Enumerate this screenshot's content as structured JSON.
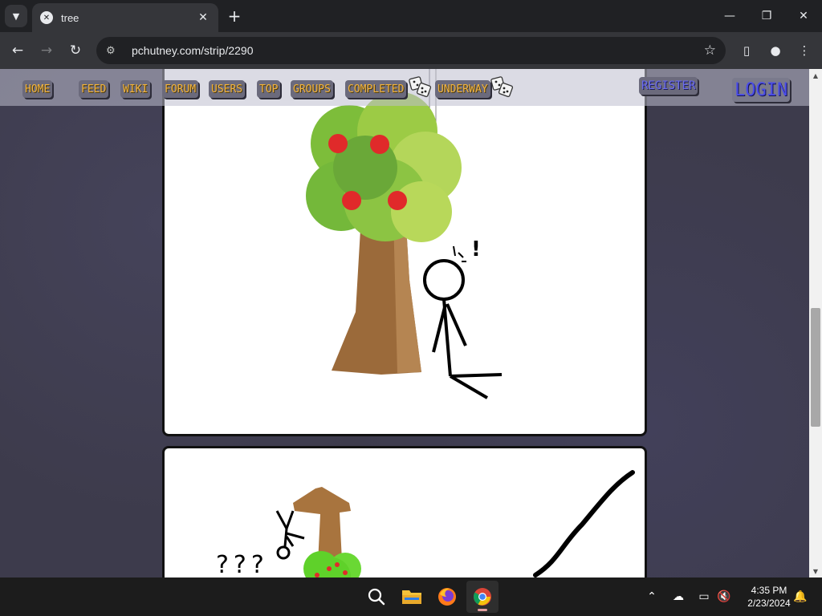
{
  "browser": {
    "tab_title": "tree",
    "url": "pchutney.com/strip/2290",
    "menu_icon": "chevron-down-icon",
    "favicon": "site-favicon"
  },
  "site_nav": {
    "links": [
      "HOME",
      "FEED",
      "WIKI",
      "FORUM",
      "USERS",
      "TOP",
      "GROUPS",
      "COMPLETED",
      "UNDERWAY"
    ],
    "register": "REGISTER",
    "login": "LOGIN",
    "link_color": "#f2b33d",
    "login_color": "#4b4de8"
  },
  "comic": {
    "panel1_exclaim": "!",
    "panel2_question": "???"
  },
  "taskbar": {
    "time": "4:35 PM",
    "date": "2/23/2024"
  }
}
